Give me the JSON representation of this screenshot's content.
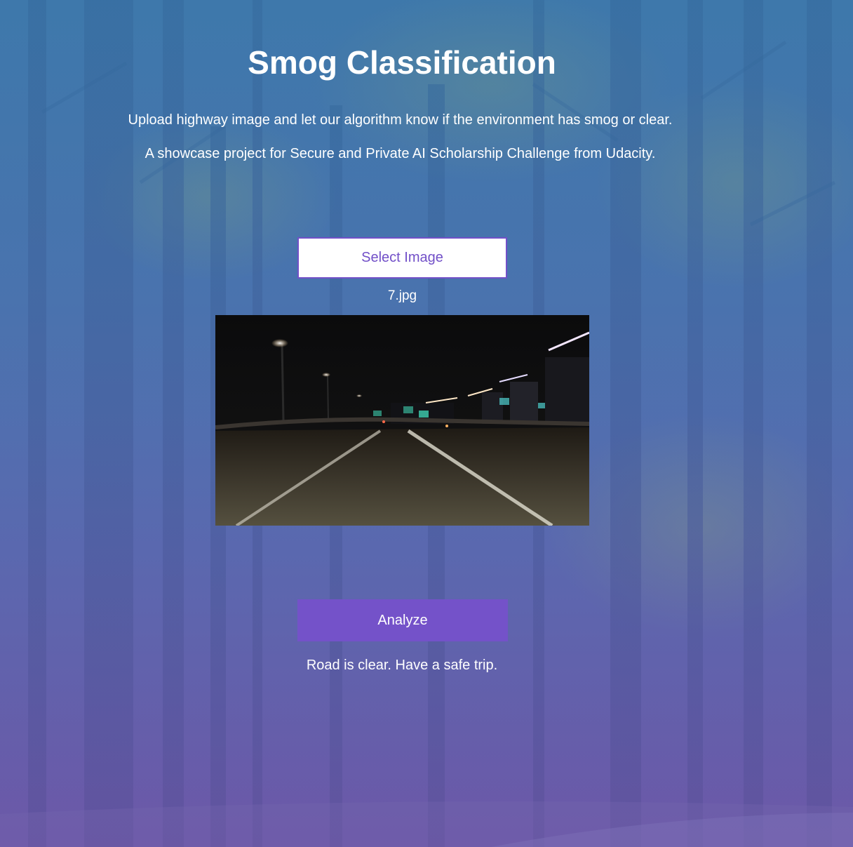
{
  "page": {
    "title": "Smog Classification",
    "description": "Upload highway image and let our algorithm know if the environment has smog or clear.",
    "subtitle": "A showcase project for Secure and Private AI Scholarship Challenge from Udacity."
  },
  "upload": {
    "select_label": "Select Image",
    "filename": "7.jpg",
    "preview_icon": "highway-night-photo"
  },
  "analysis": {
    "analyze_label": "Analyze",
    "result_text": "Road is clear. Have a safe trip."
  },
  "colors": {
    "accent": "#7452c9",
    "background_top": "#3f78a8",
    "background_bottom": "#6a5aa6",
    "text": "#ffffff"
  }
}
